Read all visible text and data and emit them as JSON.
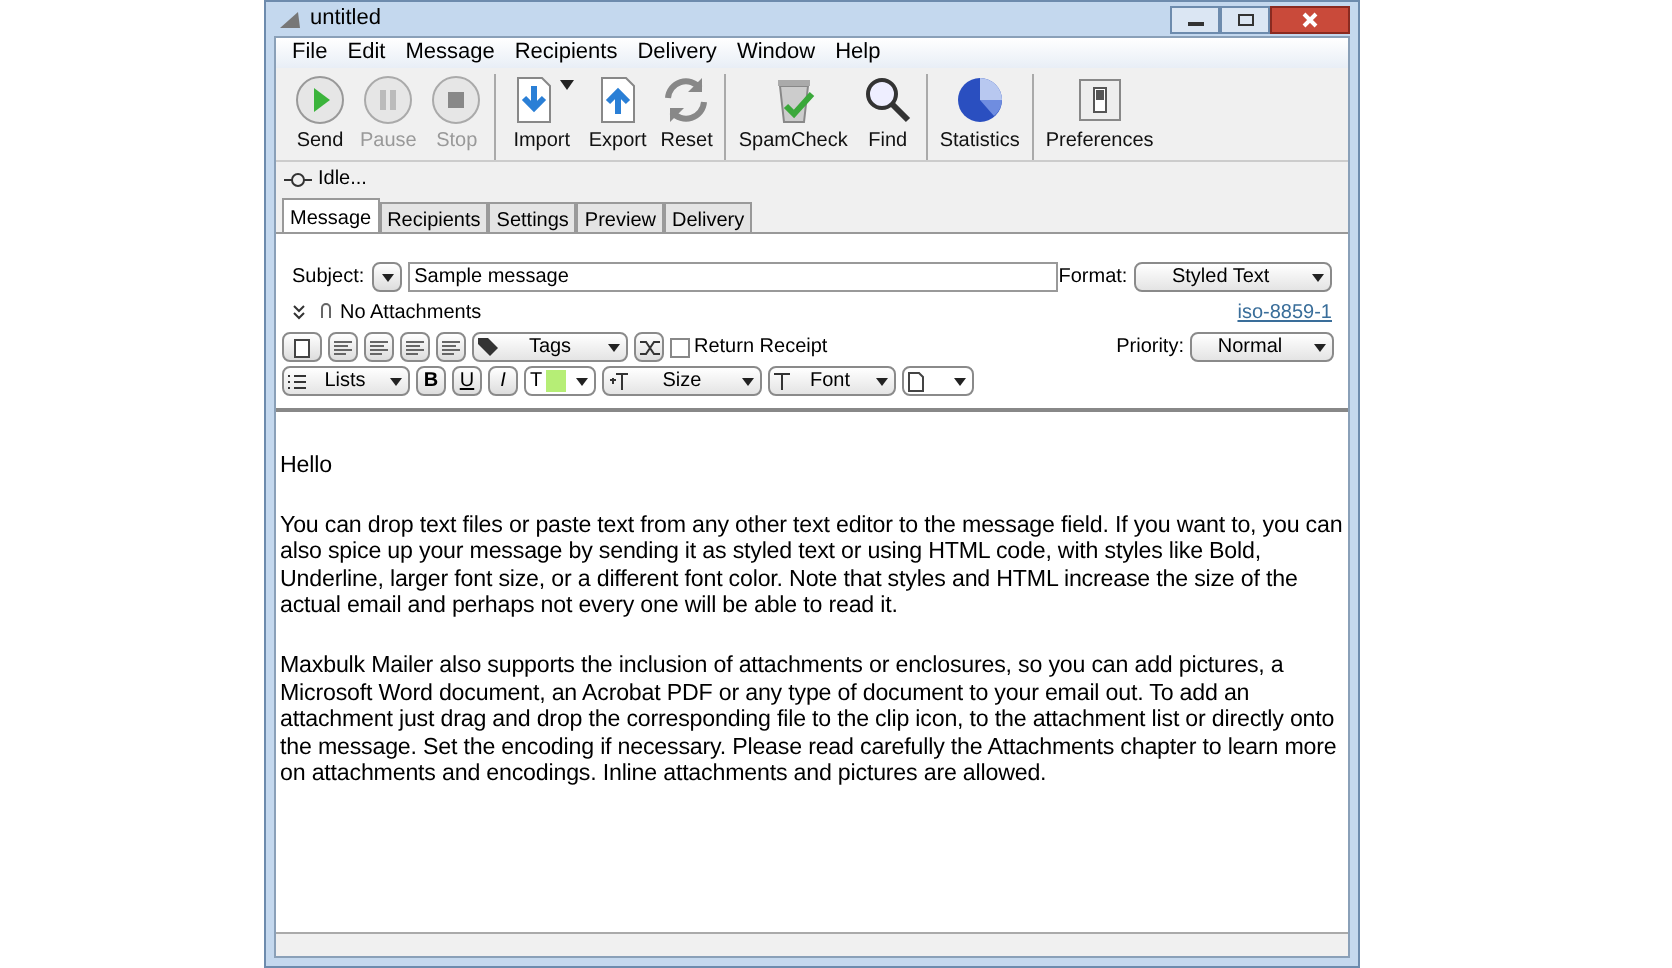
{
  "window": {
    "title": "untitled"
  },
  "menu": [
    "File",
    "Edit",
    "Message",
    "Recipients",
    "Delivery",
    "Window",
    "Help"
  ],
  "toolbar": [
    [
      {
        "kind": "send",
        "label": "Send",
        "disabled": false
      },
      {
        "kind": "pause",
        "label": "Pause",
        "disabled": true
      },
      {
        "kind": "stop",
        "label": "Stop",
        "disabled": true
      }
    ],
    [
      {
        "kind": "import",
        "label": "Import",
        "disabled": false
      },
      {
        "kind": "export",
        "label": "Export",
        "disabled": false
      },
      {
        "kind": "reset",
        "label": "Reset",
        "disabled": false
      }
    ],
    [
      {
        "kind": "spamcheck",
        "label": "SpamCheck",
        "disabled": false
      },
      {
        "kind": "find",
        "label": "Find",
        "disabled": false
      }
    ],
    [
      {
        "kind": "statistics",
        "label": "Statistics",
        "disabled": false
      }
    ],
    [
      {
        "kind": "preferences",
        "label": "Preferences",
        "disabled": false
      }
    ]
  ],
  "status": "Idle...",
  "tabs": [
    {
      "label": "Message",
      "selected": true
    },
    {
      "label": "Recipients",
      "selected": false
    },
    {
      "label": "Settings",
      "selected": false
    },
    {
      "label": "Preview",
      "selected": false
    },
    {
      "label": "Delivery",
      "selected": false
    }
  ],
  "subject": {
    "label": "Subject:",
    "value": "Sample message"
  },
  "format": {
    "label": "Format:",
    "value": "Styled Text"
  },
  "attachments": "No Attachments",
  "encoding": "iso-8859-1",
  "tags": "Tags",
  "return_receipt": {
    "label": "Return Receipt",
    "checked": false
  },
  "priority": {
    "label": "Priority:",
    "value": "Normal"
  },
  "lists": "Lists",
  "bold": "B",
  "underline": "U",
  "italic": "I",
  "text_color": "T",
  "size": "Size",
  "font": "Font",
  "body": [
    "Hello",
    "You can drop text files or paste text from any other text editor to the message field. If you want to, you can also spice up your message by sending it as styled text or using HTML code, with styles like Bold, Underline, larger font size, or a different font color. Note that styles and HTML increase the size of the actual email and perhaps not every one will be able to read it.",
    "Maxbulk Mailer also supports the inclusion of attachments or enclosures, so you can add pictures, a Microsoft Word document, an Acrobat PDF or any type of document to your email out. To add an attachment just drag and drop the corresponding file to the clip icon, to the attachment list or directly onto the message. Set the encoding if necessary. Please read carefully the Attachments chapter to learn more on attachments and encodings. Inline attachments and pictures are allowed."
  ]
}
